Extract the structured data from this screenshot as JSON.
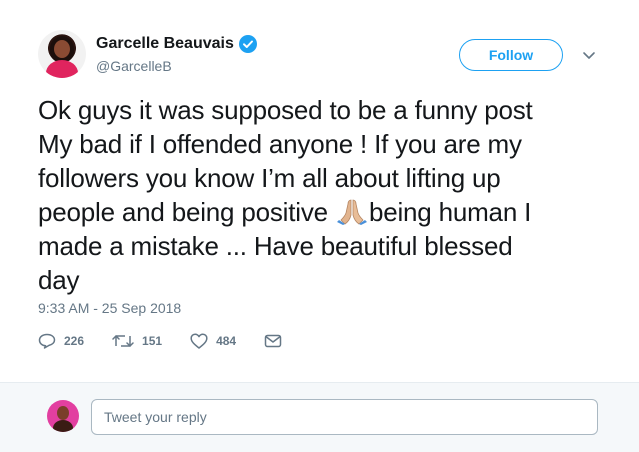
{
  "author": {
    "display_name": "Garcelle Beauvais",
    "handle": "@GarcelleB"
  },
  "follow_label": "Follow",
  "tweet": {
    "lines": [
      "Ok guys it was supposed to be a funny post",
      "My bad if I offended anyone ! If you are my",
      "followers you know I’m all about lifting up",
      "people and being positive ",
      "being human I",
      "made a mistake ... Have beautiful blessed",
      "day"
    ],
    "emoji": "folded-hands-emoji"
  },
  "timestamp": "9:33 AM - 25 Sep 2018",
  "actions": {
    "replies": "226",
    "retweets": "151",
    "likes": "484"
  },
  "reply": {
    "placeholder": "Tweet your reply"
  },
  "colors": {
    "accent": "#1da1f2",
    "text": "#14171a",
    "muted": "#657786"
  }
}
